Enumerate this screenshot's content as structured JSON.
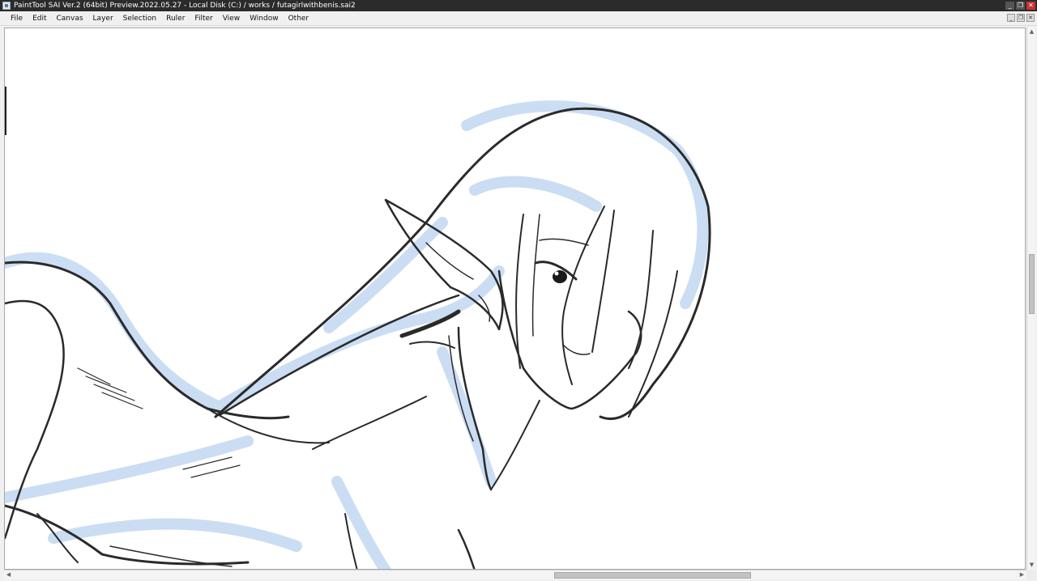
{
  "window": {
    "title": "PaintTool SAI Ver.2 (64bit) Preview.2022.05.27 - Local Disk (C:) / works / futagirlwithbenis.sai2",
    "controls": [
      "minimize-icon",
      "restore-icon",
      "close-icon"
    ]
  },
  "menu": {
    "items": [
      {
        "label": "File"
      },
      {
        "label": "Edit"
      },
      {
        "label": "Canvas"
      },
      {
        "label": "Layer"
      },
      {
        "label": "Selection"
      },
      {
        "label": "Ruler"
      },
      {
        "label": "Filter"
      },
      {
        "label": "View"
      },
      {
        "label": "Window"
      },
      {
        "label": "Other"
      }
    ],
    "document_controls": [
      "minimize-icon",
      "restore-icon",
      "close-icon"
    ]
  },
  "canvas": {
    "content": "sketch-drawing",
    "stroke_color": "#2a2a2a",
    "tint_color": "#a8c8ec"
  },
  "scrollbars": {
    "vertical_position": 0.43,
    "horizontal_position": 0.54
  }
}
